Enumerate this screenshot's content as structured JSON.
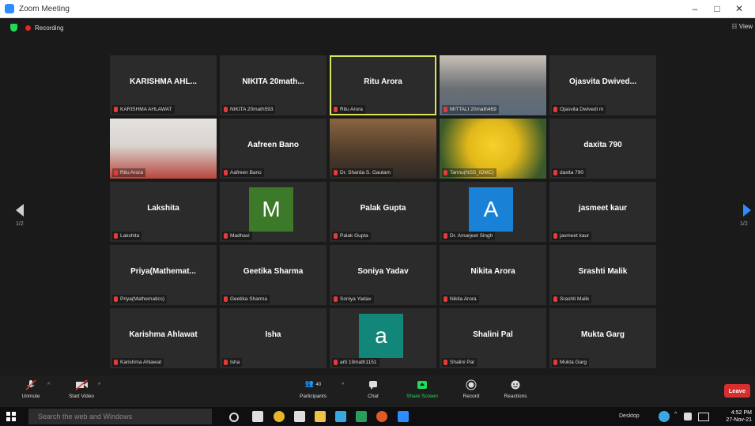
{
  "window": {
    "title": "Zoom Meeting",
    "controls": [
      "–",
      "□",
      "✕"
    ]
  },
  "topbar": {
    "recording_label": "Recording",
    "view_label": "View"
  },
  "nav": {
    "left_page": "1/2",
    "right_page": "1/2"
  },
  "participants": [
    {
      "display": "KARISHMA AHL...",
      "label": "KARISHMA AHLAWAT",
      "type": "name"
    },
    {
      "display": "NIKITA 20math...",
      "label": "NIKITA 20math593",
      "type": "name"
    },
    {
      "display": "Ritu Arora",
      "label": "Ritu Arora",
      "type": "name",
      "active": true
    },
    {
      "display": "",
      "label": "MITTALI 20math469",
      "type": "photo"
    },
    {
      "display": "Ojasvita Dwived...",
      "label": "Ojasvita Dwivedi m",
      "type": "name"
    },
    {
      "display": "",
      "label": "Ritu Arora",
      "type": "photo"
    },
    {
      "display": "Aafreen Bano",
      "label": "Aafreen Bano",
      "type": "name"
    },
    {
      "display": "",
      "label": "Dr. Sharda S. Gautam",
      "type": "photo"
    },
    {
      "display": "",
      "label": "Tannu(NSS_IDMC)",
      "type": "photo"
    },
    {
      "display": "daxita 790",
      "label": "daxita 790",
      "type": "name"
    },
    {
      "display": "Lakshita",
      "label": "Lakshita",
      "type": "name"
    },
    {
      "display": "",
      "label": "Madhavi",
      "type": "initial",
      "initial": "M",
      "color": "#3c7a2a"
    },
    {
      "display": "Palak Gupta",
      "label": "Palak Gupta",
      "type": "name"
    },
    {
      "display": "",
      "label": "Dr. Amarjeet Singh",
      "type": "initial",
      "initial": "A",
      "color": "#1a82d6"
    },
    {
      "display": "jasmeet kaur",
      "label": "jasmeet kaur",
      "type": "name"
    },
    {
      "display": "Priya(Mathemat...",
      "label": "Priya(Mathematics)",
      "type": "name"
    },
    {
      "display": "Geetika Sharma",
      "label": "Geetika Sharma",
      "type": "name"
    },
    {
      "display": "Soniya Yadav",
      "label": "Soniya Yadav",
      "type": "name"
    },
    {
      "display": "Nikita Arora",
      "label": "Nikita Arora",
      "type": "name"
    },
    {
      "display": "Srashti Malik",
      "label": "Srashti Malik",
      "type": "name"
    },
    {
      "display": "Karishma Ahlawat",
      "label": "Karishma Ahlawat",
      "type": "name"
    },
    {
      "display": "Isha",
      "label": "Isha",
      "type": "name"
    },
    {
      "display": "",
      "label": "arti 19math1151",
      "type": "initial",
      "initial": "a",
      "color": "#13867a"
    },
    {
      "display": "Shalini Pal",
      "label": "Shalini Pal",
      "type": "name"
    },
    {
      "display": "Mukta Garg",
      "label": "Mukta Garg",
      "type": "name"
    }
  ],
  "controls": {
    "unmute": "Unmute",
    "start_video": "Start Video",
    "participants": "Participants",
    "participant_count": "40",
    "chat": "Chat",
    "share_screen": "Share Screen",
    "record": "Record",
    "reactions": "Reactions",
    "leave": "Leave"
  },
  "taskbar": {
    "search_placeholder": "Search the web and Windows",
    "desktop_label": "Desktop",
    "time": "4:52 PM",
    "date": "27-Nov-21"
  },
  "colors": {
    "active_speaker": "#d8e35e",
    "leave": "#d72f2f",
    "share": "#23d959",
    "brand": "#2d8cff"
  }
}
